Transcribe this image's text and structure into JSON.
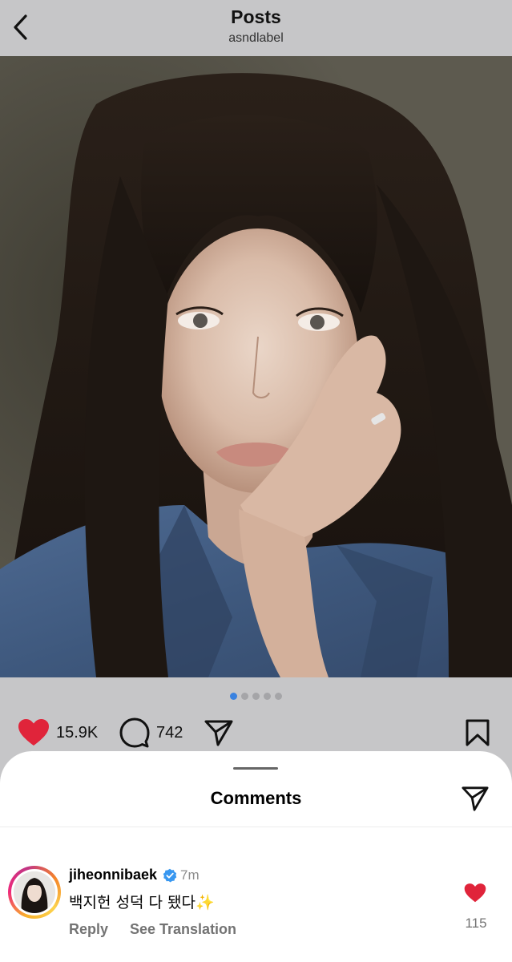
{
  "header": {
    "title": "Posts",
    "username": "asndlabel"
  },
  "carousel": {
    "total": 5,
    "active_index": 0
  },
  "actions": {
    "likes": "15.9K",
    "comments": "742"
  },
  "comments_sheet": {
    "title": "Comments",
    "comment": {
      "username": "jiheonnibaek",
      "time": "7m",
      "text": "백지헌 성덕 다 됐다✨",
      "reply_label": "Reply",
      "translate_label": "See Translation",
      "like_count": "115"
    }
  },
  "colors": {
    "like_red": "#e0243a",
    "active_dot": "#3a82e0",
    "verified_blue": "#3897f0"
  },
  "icons": [
    "chevron-left-icon",
    "heart-icon",
    "comment-bubble-icon",
    "paper-plane-icon",
    "bookmark-icon",
    "verified-badge-icon"
  ]
}
